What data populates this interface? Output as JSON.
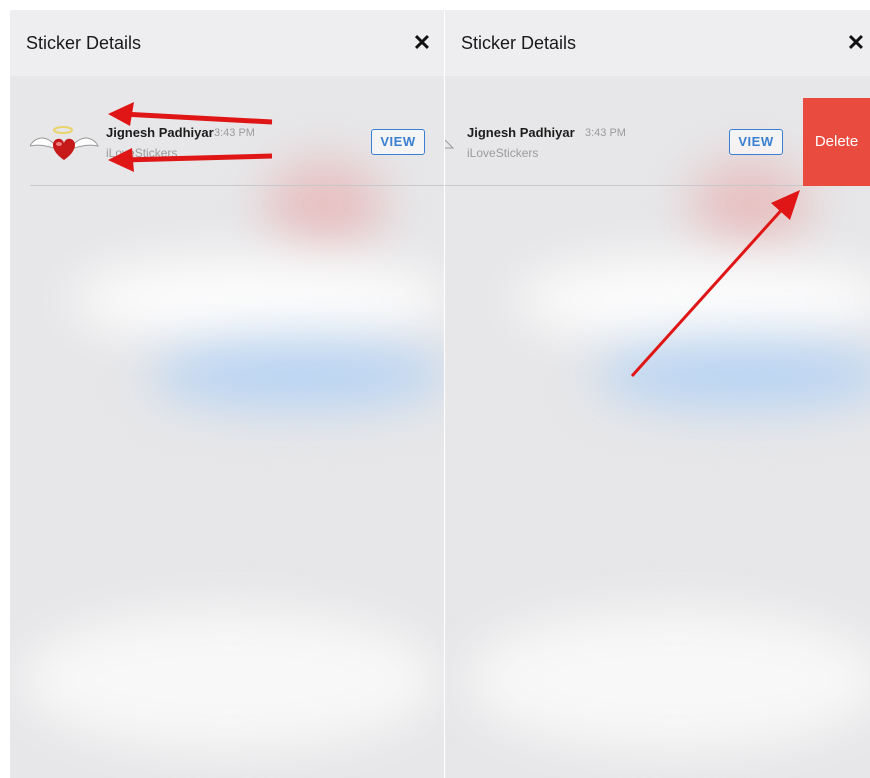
{
  "header": {
    "title": "Sticker Details"
  },
  "sticker": {
    "sender": "Jignesh Padhiyar",
    "time": "3:43 PM",
    "pack": "iLoveStickers",
    "view_label": "VIEW",
    "delete_label": "Delete"
  },
  "colors": {
    "view_accent": "#3a7fd1",
    "delete_bg": "#e94b3f",
    "annotation_arrow": "#e01515"
  },
  "icons": {
    "close": "close-icon",
    "sticker": "winged-heart-sticker-icon"
  }
}
